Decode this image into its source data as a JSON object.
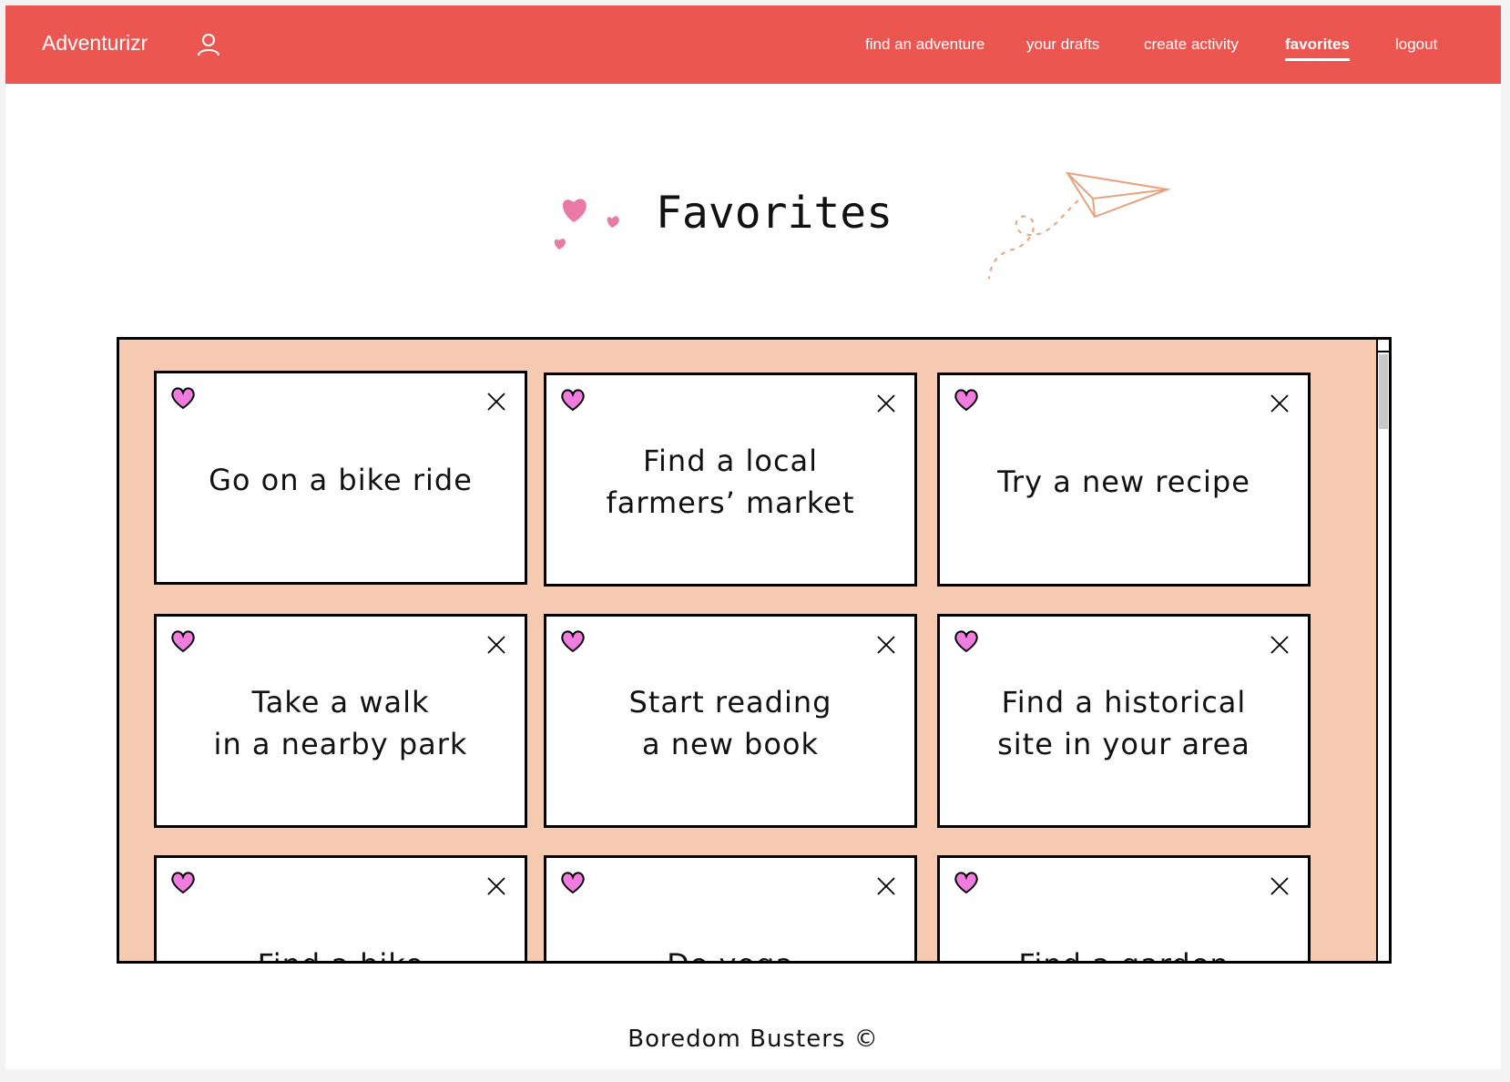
{
  "header": {
    "brand": "Adventurizr",
    "nav": [
      {
        "label": "find an adventure"
      },
      {
        "label": "your drafts"
      },
      {
        "label": "create activity"
      },
      {
        "label": "favorites"
      },
      {
        "label": "logout"
      }
    ],
    "active_nav": "favorites",
    "background_color": "#eb5651"
  },
  "main": {
    "title": "Favorites",
    "panel_color": "#f7cbb1",
    "cards": [
      {
        "label": "Go on a bike ride"
      },
      {
        "label": "Find a local\nfarmers’ market"
      },
      {
        "label": "Try a new recipe"
      },
      {
        "label": "Take a walk\nin a nearby park"
      },
      {
        "label": "Start reading\na new book"
      },
      {
        "label": "Find a historical\nsite in your area"
      },
      {
        "label": "Find a hike"
      },
      {
        "label": "Do yoga"
      },
      {
        "label": "Find a garden"
      }
    ],
    "card_icons": {
      "favorite": "heart-icon",
      "remove": "close-icon"
    },
    "heart_color": "#f07ce0"
  },
  "footer": {
    "text": "Boredom Busters ©"
  }
}
